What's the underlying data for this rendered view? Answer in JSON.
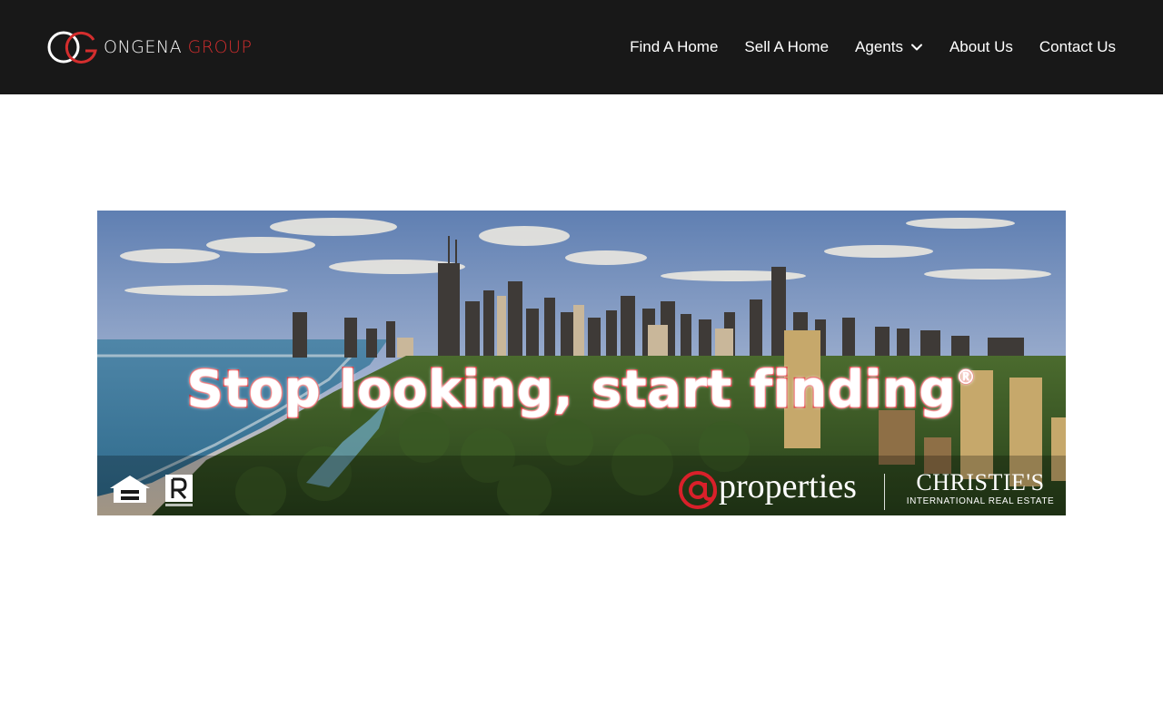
{
  "header": {
    "logo": {
      "icon": "og-monogram-icon",
      "word_a": "ONGENA",
      "word_b": "GROUP",
      "accent_color": "#d42e2e"
    },
    "nav": [
      {
        "label": "Find A Home"
      },
      {
        "label": "Sell A Home"
      },
      {
        "label": "Agents",
        "icon": "chevron-down-icon"
      },
      {
        "label": "About Us"
      },
      {
        "label": "Contact Us"
      }
    ],
    "background": "#181818"
  },
  "banner": {
    "headline": "Stop looking, start finding",
    "headline_mark": "®",
    "headline_stroke_color": "#e0141b",
    "icons": [
      "equal-housing-opportunity-icon",
      "realtor-r-icon"
    ],
    "brand_properties": {
      "mark": "@",
      "word": "properties"
    },
    "brand_christies": {
      "name": "CHRISTIE'S",
      "subtitle": "INTERNATIONAL REAL ESTATE"
    }
  }
}
